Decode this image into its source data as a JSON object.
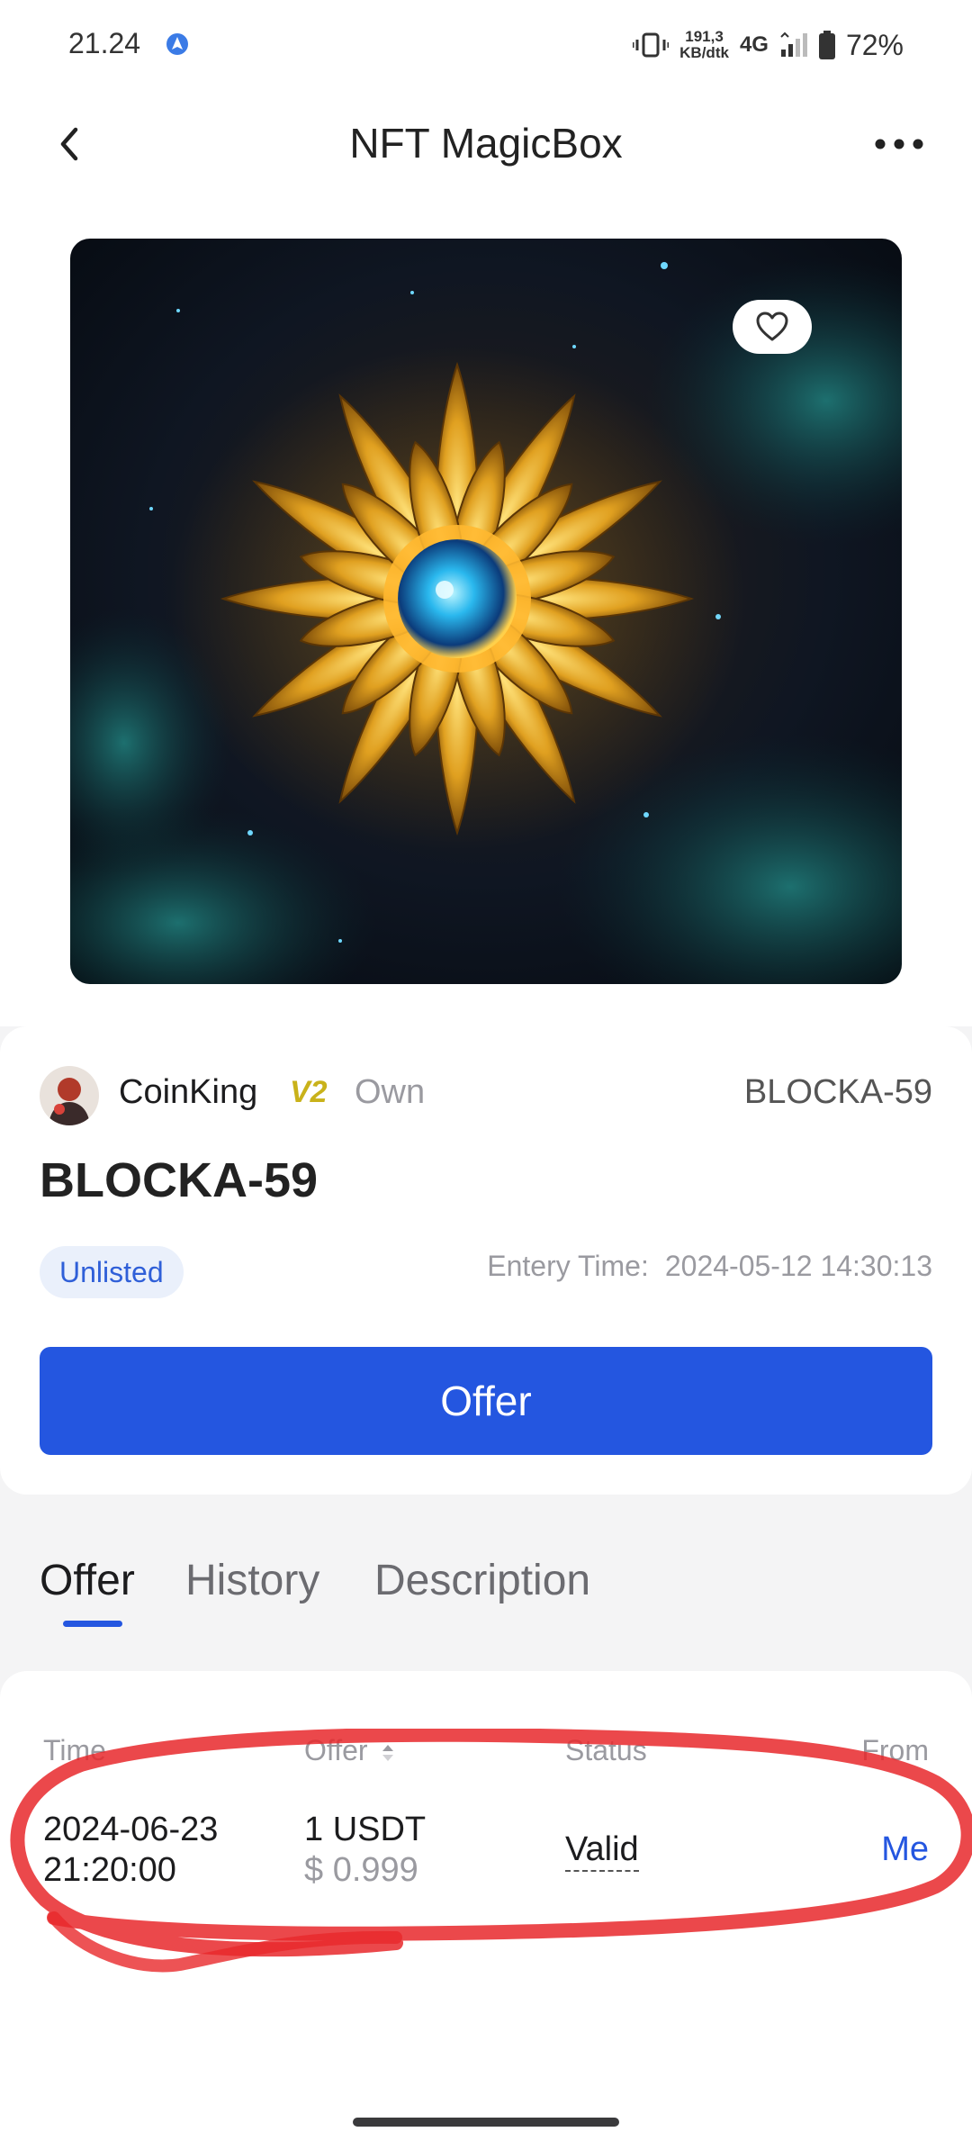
{
  "status_bar": {
    "time": "21.24",
    "speed_value": "191,3",
    "speed_unit": "KB/dtk",
    "network": "4G",
    "battery": "72%"
  },
  "header": {
    "title": "NFT MagicBox"
  },
  "nft": {
    "owner_name": "CoinKing",
    "level_badge": "V2",
    "own_label": "Own",
    "token_id": "BLOCKA-59",
    "title": "BLOCKA-59",
    "listing_status": "Unlisted",
    "entry_time_label": "Entery Time:",
    "entry_time_value": "2024-05-12 14:30:13"
  },
  "actions": {
    "offer_label": "Offer"
  },
  "tabs": [
    {
      "label": "Offer",
      "active": true
    },
    {
      "label": "History",
      "active": false
    },
    {
      "label": "Description",
      "active": false
    }
  ],
  "offers_table": {
    "headers": {
      "time": "Time",
      "offer": "Offer",
      "status": "Status",
      "from": "From"
    },
    "rows": [
      {
        "date": "2024-06-23",
        "time": "21:20:00",
        "amount": "1 USDT",
        "usd_value": "$ 0.999",
        "status": "Valid",
        "from": "Me"
      }
    ]
  },
  "colors": {
    "accent": "#2456e0",
    "annotation": "#e8282b",
    "badge_bg": "#eaf0fb",
    "level_gold": "#c9b21a"
  },
  "icons": {
    "back": "chevron-left-icon",
    "more": "more-dots-icon",
    "favorite": "heart-icon",
    "location": "location-arrow-icon",
    "vibrate": "vibrate-icon",
    "signal": "signal-icon",
    "battery": "battery-icon",
    "sort": "sort-icon"
  }
}
